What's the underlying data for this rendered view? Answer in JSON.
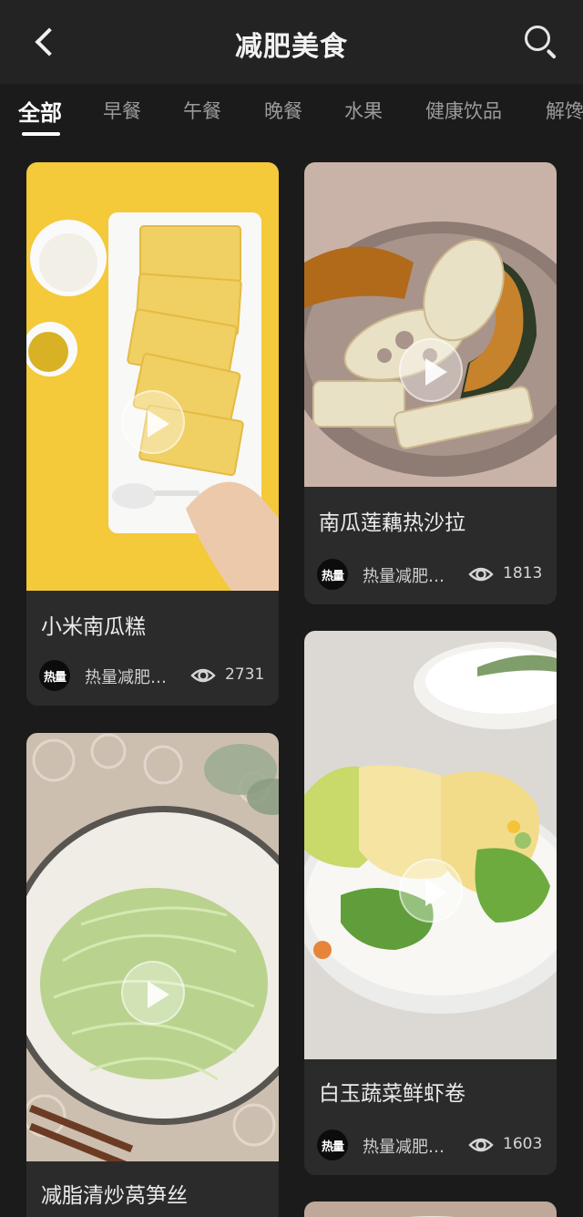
{
  "header": {
    "title": "减肥美食"
  },
  "tabs": [
    {
      "label": "全部",
      "active": true
    },
    {
      "label": "早餐",
      "active": false
    },
    {
      "label": "午餐",
      "active": false
    },
    {
      "label": "晚餐",
      "active": false
    },
    {
      "label": "水果",
      "active": false
    },
    {
      "label": "健康饮品",
      "active": false
    },
    {
      "label": "解馋",
      "active": false
    }
  ],
  "cards": [
    {
      "title": "小米南瓜糕",
      "author": "热量减肥…",
      "avatar_text": "热量",
      "views": "2731"
    },
    {
      "title": "南瓜莲藕热沙拉",
      "author": "热量减肥…",
      "avatar_text": "热量",
      "views": "1813"
    },
    {
      "title": "减脂清炒莴笋丝",
      "author": "",
      "avatar_text": "",
      "views": ""
    },
    {
      "title": "白玉蔬菜鲜虾卷",
      "author": "热量减肥…",
      "avatar_text": "热量",
      "views": "1603"
    }
  ],
  "icons": {
    "back": "chevron-left-icon",
    "search": "search-icon",
    "play": "play-icon",
    "views": "eye-icon"
  },
  "colors": {
    "background": "#1b1b1b",
    "header_bg": "#232323",
    "card_bg": "#2b2b2b",
    "accent": "#ffffff"
  }
}
